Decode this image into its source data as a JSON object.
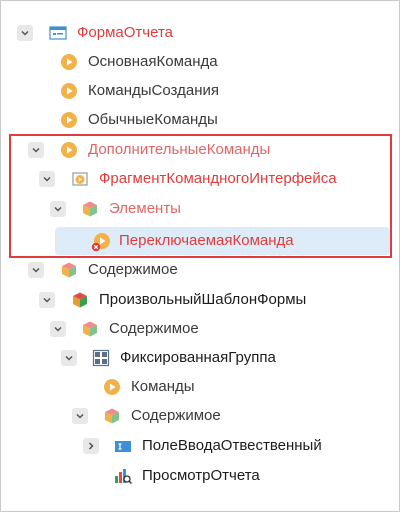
{
  "tree": {
    "items": [
      {
        "label": "ФормаОтчета",
        "icon": "form-icon"
      },
      {
        "label": "ОсновнаяКоманда",
        "icon": "command-icon"
      },
      {
        "label": "КомандыСоздания",
        "icon": "command-icon"
      },
      {
        "label": "ОбычныеКоманды",
        "icon": "command-icon"
      },
      {
        "label": "ДополнительныеКоманды",
        "icon": "command-icon"
      },
      {
        "label": "ФрагментКомандногоИнтерфейса",
        "icon": "interface-fragment-icon"
      },
      {
        "label": "Элементы",
        "icon": "elements-cube-icon"
      },
      {
        "label": "ПереключаемаяКоманда",
        "icon": "command-error-icon"
      },
      {
        "label": "Содержимое",
        "icon": "content-cube-icon"
      },
      {
        "label": "ПроизвольныйШаблонФормы",
        "icon": "template-cube-icon"
      },
      {
        "label": "Содержимое",
        "icon": "content-cube-icon"
      },
      {
        "label": "ФиксированнаяГруппа",
        "icon": "group-grid-icon"
      },
      {
        "label": "Команды",
        "icon": "command-icon"
      },
      {
        "label": "Содержимое",
        "icon": "content-cube-icon"
      },
      {
        "label": "ПолеВводаОтвественный",
        "icon": "input-field-icon"
      },
      {
        "label": "ПросмотрОтчета",
        "icon": "report-view-icon"
      }
    ]
  },
  "colors": {
    "highlight_border": "#e23b3b",
    "selection": "#ddecf8",
    "red_text": "#e03c3c",
    "command_icon": "#f2b24a"
  }
}
